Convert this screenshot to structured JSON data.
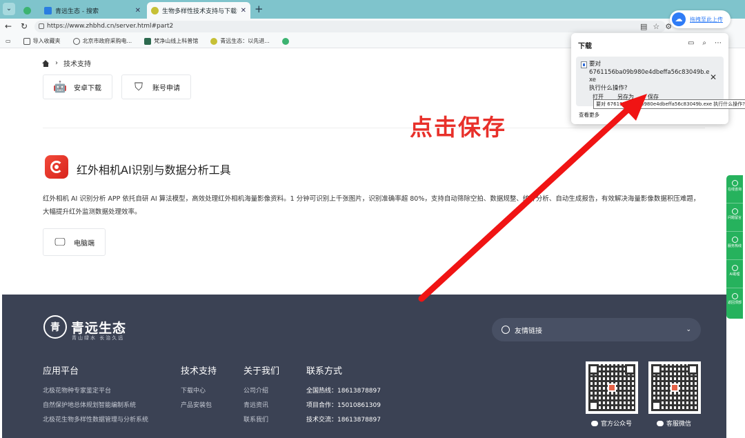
{
  "browser": {
    "tabs": [
      {
        "label": "",
        "active": false
      },
      {
        "label": "青远生态 - 搜索",
        "active": false
      },
      {
        "label": "生物多样性技术支持与下载中心",
        "active": true
      }
    ],
    "url": "https://www.zhbhd.cn/server.html#part2",
    "bookmarks": [
      "导入收藏夹",
      "北京市政府采购电...",
      "梵净山线上科普馆",
      "青远生态：以先进...",
      ""
    ],
    "extension_label": "拖拽至此上传"
  },
  "page": {
    "breadcrumb": "技术支持",
    "buttons": {
      "android": "安卓下载",
      "account": "账号申请",
      "pc": "电脑端"
    },
    "tool": {
      "title": "红外相机AI识别与数据分析工具",
      "description": "红外相机 AI 识别分析 APP 依托自研 AI 算法模型，高效处理红外相机海量影像资料。1 分钟可识别上千张图片，识别准确率超 80%，支持自动筛除空拍、数据规整、统计分析、自动生成报告，有效解决海量影像数据积压难题，大幅提升红外监测数据处理效率。"
    }
  },
  "footer": {
    "logo_name": "青远生态",
    "logo_slogan": "青山绿水 长治久远",
    "friend_links": "友情链接",
    "cols": {
      "apps": {
        "title": "应用平台",
        "items": [
          "北极花物种专家鉴定平台",
          "自然保护地总体规划智能编制系统",
          "北极花生物多样性数据管理与分析系统"
        ]
      },
      "support": {
        "title": "技术支持",
        "items": [
          "下载中心",
          "产品安装包"
        ]
      },
      "about": {
        "title": "关于我们",
        "items": [
          "公司介绍",
          "青远资讯",
          "联系我们"
        ]
      },
      "contact": {
        "title": "联系方式",
        "items": [
          "全国热线：18613878897",
          "项目合作：15010861309",
          "技术交流：18613878897"
        ]
      }
    },
    "qr_labels": [
      "官方公众号",
      "客服微信"
    ]
  },
  "side_toolbar": [
    "在线咨询",
    "问题留言",
    "服务热线",
    "AI助理",
    "返回顶部"
  ],
  "download_panel": {
    "title": "下载",
    "line1": "要对",
    "filename": "6761156ba09b980e4dbeffa56c83049b.exe",
    "line3": "执行什么操作?",
    "actions": [
      "打开",
      "另存为",
      "保存"
    ],
    "see_more": "查看更多",
    "tooltip": "要对 6761156ba09b980e4dbeffa56c83049b.exe 执行什么操作?"
  },
  "annotation": {
    "text": "点击保存",
    "color": "#e8302a"
  },
  "colors": {
    "footer_bg": "#3b4254",
    "side_green": "#26b25d",
    "tabbar": "#7fc4cc"
  }
}
